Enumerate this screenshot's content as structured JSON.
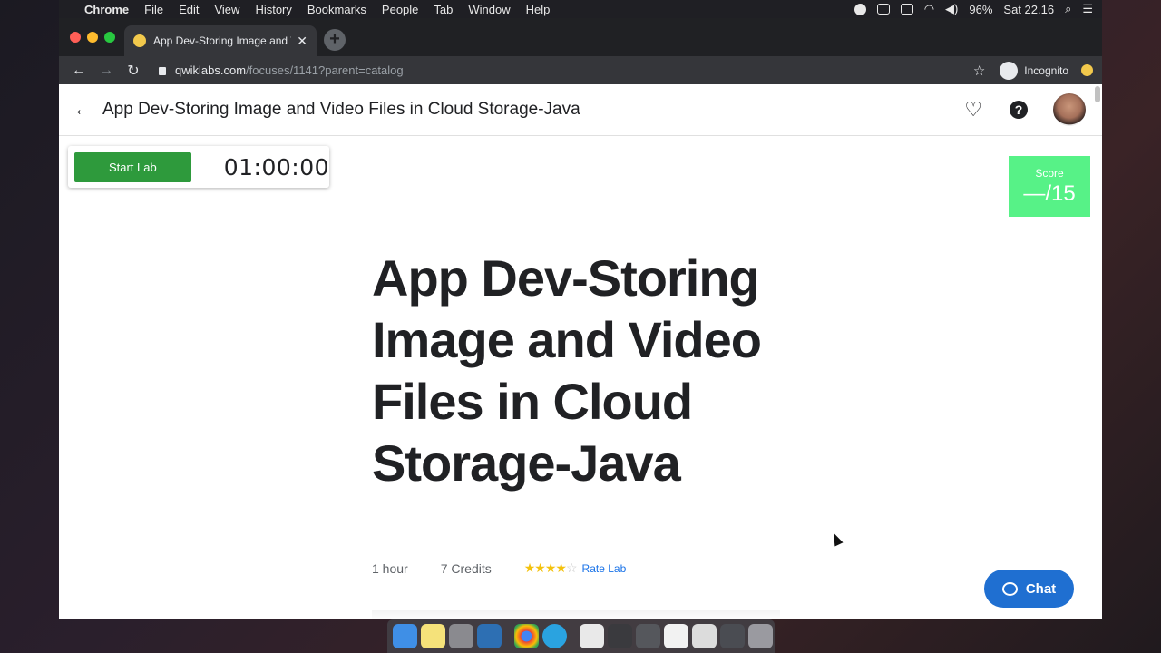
{
  "menubar": {
    "app_name": "Chrome",
    "items": [
      "File",
      "Edit",
      "View",
      "History",
      "Bookmarks",
      "People",
      "Tab",
      "Window",
      "Help"
    ],
    "battery": "96%",
    "clock": "Sat 22.16"
  },
  "browser": {
    "tab_title": "App Dev-Storing Image and Vi",
    "url_host": "qwiklabs.com",
    "url_path": "/focuses/1141?parent=catalog",
    "incognito_label": "Incognito"
  },
  "page": {
    "header_title": "App Dev-Storing Image and Video Files in Cloud Storage-Java",
    "start_lab_label": "Start Lab",
    "timer": "01:00:00",
    "score_label": "Score",
    "score_value": "—/15",
    "hero_title": "App Dev-Storing Image and Video Files in Cloud Storage-Java",
    "duration": "1 hour",
    "credits": "7 Credits",
    "rating_stars": 4,
    "rating_max": 5,
    "rate_label": "Rate Lab",
    "chat_label": "Chat"
  },
  "colors": {
    "start_button": "#2e9a3c",
    "score_box": "#57f287",
    "chat_button": "#1f6fd1",
    "link": "#1a73e8"
  }
}
